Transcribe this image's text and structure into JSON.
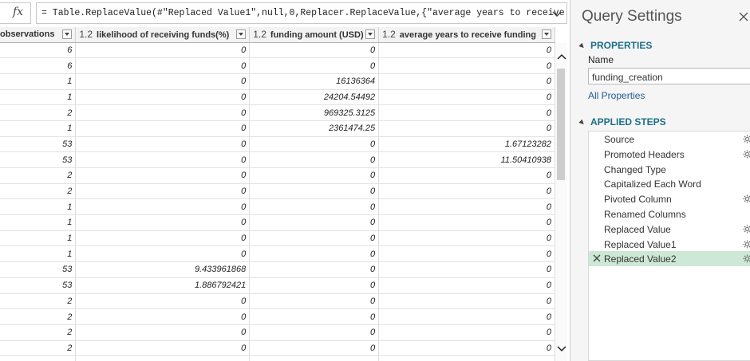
{
  "formula_bar": {
    "fx_label": "fx",
    "formula": "= Table.ReplaceValue(#\"Replaced Value1\",null,0,Replacer.ReplaceValue,{\"average years to receive"
  },
  "table": {
    "columns": [
      {
        "type": "",
        "name": "observations"
      },
      {
        "type": "1.2",
        "name": "likelihood of receiving funds(%)"
      },
      {
        "type": "1.2",
        "name": "funding amount (USD)"
      },
      {
        "type": "1.2",
        "name": "average years to receive funding"
      }
    ],
    "rows": [
      [
        "6",
        "0",
        "0",
        "0"
      ],
      [
        "6",
        "0",
        "0",
        "0"
      ],
      [
        "1",
        "0",
        "16136364",
        "0"
      ],
      [
        "1",
        "0",
        "24204.54492",
        "0"
      ],
      [
        "2",
        "0",
        "969325.3125",
        "0"
      ],
      [
        "1",
        "0",
        "2361474.25",
        "0"
      ],
      [
        "53",
        "0",
        "0",
        "1.67123282"
      ],
      [
        "53",
        "0",
        "0",
        "11.50410938"
      ],
      [
        "2",
        "0",
        "0",
        "0"
      ],
      [
        "2",
        "0",
        "0",
        "0"
      ],
      [
        "1",
        "0",
        "0",
        "0"
      ],
      [
        "1",
        "0",
        "0",
        "0"
      ],
      [
        "1",
        "0",
        "0",
        "0"
      ],
      [
        "1",
        "0",
        "0",
        "0"
      ],
      [
        "53",
        "9.433961868",
        "0",
        "0"
      ],
      [
        "53",
        "1.886792421",
        "0",
        "0"
      ],
      [
        "2",
        "0",
        "0",
        "0"
      ],
      [
        "2",
        "0",
        "0",
        "0"
      ],
      [
        "2",
        "0",
        "0",
        "0"
      ],
      [
        "2",
        "0",
        "0",
        "0"
      ],
      [
        "",
        "",
        "",
        ""
      ]
    ]
  },
  "query_settings": {
    "title": "Query Settings",
    "properties_header": "PROPERTIES",
    "name_label": "Name",
    "name_value": "funding_creation",
    "all_properties_link": "All Properties",
    "applied_steps_header": "APPLIED STEPS",
    "steps": [
      {
        "label": "Source",
        "gear": true,
        "active": false
      },
      {
        "label": "Promoted Headers",
        "gear": true,
        "active": false
      },
      {
        "label": "Changed Type",
        "gear": false,
        "active": false
      },
      {
        "label": "Capitalized Each Word",
        "gear": false,
        "active": false
      },
      {
        "label": "Pivoted Column",
        "gear": true,
        "active": false
      },
      {
        "label": "Renamed Columns",
        "gear": false,
        "active": false
      },
      {
        "label": "Replaced Value",
        "gear": true,
        "active": false
      },
      {
        "label": "Replaced Value1",
        "gear": true,
        "active": false
      },
      {
        "label": "Replaced Value2",
        "gear": true,
        "active": true
      }
    ]
  },
  "colors": {
    "accent_header": "#1d6e8a",
    "link": "#1f5c94",
    "active_step": "#cde8d6"
  },
  "icons": {
    "formula": "fx-icon",
    "expand": "chevron-down-icon",
    "close": "close-icon",
    "step_settings": "gear-icon",
    "delete_step": "x-icon",
    "scroll_up": "chevron-up-icon",
    "scroll_down": "chevron-down-icon",
    "filter": "dropdown-arrow-icon"
  }
}
